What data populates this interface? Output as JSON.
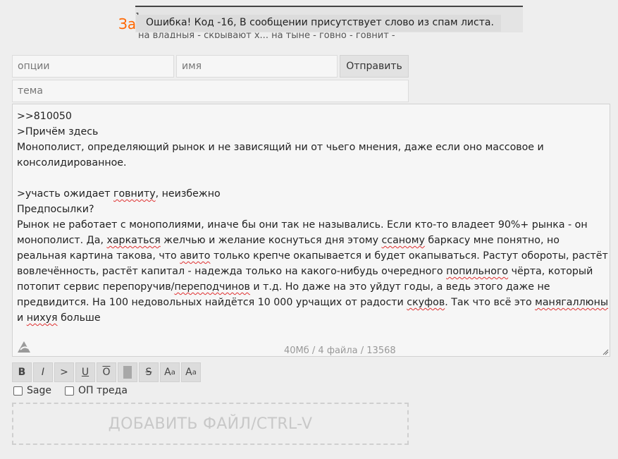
{
  "header": {
    "title_fragment": "За",
    "obscured_text": "на владныя - скрывают х... на тыне - говно - говнит -"
  },
  "toast": {
    "marker": "1",
    "message": "Ошибка! Код -16, В сообщении присутствует слово из спам листа."
  },
  "form": {
    "options_placeholder": "опции",
    "name_placeholder": "имя",
    "subject_placeholder": "тема",
    "send_label": "Отправить"
  },
  "post": {
    "line1": ">>810050",
    "line2": ">Причём здесь",
    "line3": "Монополист, определяющий рынок и не зависящий ни от чьего мнения, даже если оно массовое и консолидированное.",
    "line4a": ">участь ожидает ",
    "line4b": "говниту",
    "line4c": ", неизбежно",
    "line5": "Предпосылки?",
    "p1": "Рынок не работает с монополиями, иначе бы они так не назывались. Если кто-то владеет 90%+ рынка - он монополист. Да, ",
    "p2": "харкаться",
    "p3": " желчью и желание коснуться дня этому ",
    "p4": "ссаному",
    "p5": " баркасу мне понятно, но реальная картина такова, что ",
    "p6": "авито",
    "p7": " только крепче окапывается и будет окапываться. Растут обороты, растёт вовлечённость, растёт капитал - надежда только на какого-нибудь очередного ",
    "p8": "попильного",
    "p9": " чёрта, который потопит сервис перепоручив/",
    "p10": "переподчинов",
    "p11": " и т.д. Но даже на это уйдут годы, а ведь этого даже не предвидится. На 100 недовольных найдётся 10 000 урчащих от радости ",
    "p12": "скуфов",
    "p13": ". Так что всё это ",
    "p14": "манягаллюны",
    "p15": " и ",
    "p16": "нихуя",
    "p17": " больше"
  },
  "counter": {
    "size": "40Мб",
    "files": "4 файла",
    "chars": "13568",
    "text": "40Мб / 4 файла / 13568"
  },
  "toolbar": {
    "bold": "B",
    "italic": "I",
    "quote": ">",
    "underline": "U",
    "overline": "O",
    "strike": "S",
    "sup_base": "A",
    "sup_mark": "a",
    "sub_base": "A",
    "sub_mark": "a"
  },
  "options": {
    "sage_label": "Sage",
    "op_label": "ОП треда"
  },
  "dropzone": {
    "label": "ДОБАВИТЬ ФАЙЛ/CTRL-V"
  },
  "colors": {
    "accent": "#ff6600",
    "background": "#eeeeee",
    "spellcheck": "#e03030"
  }
}
